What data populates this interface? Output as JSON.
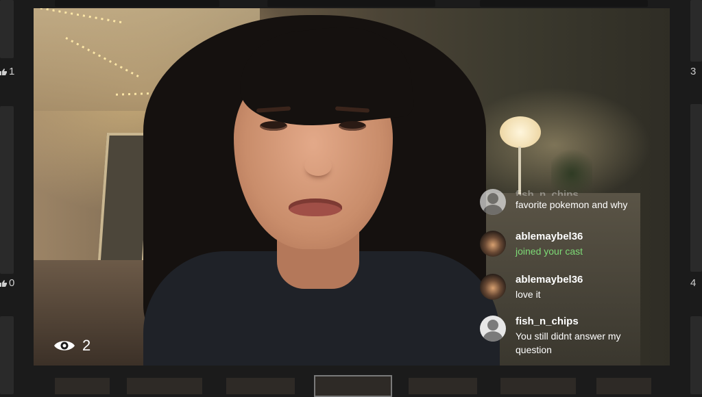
{
  "left_side": {
    "counts": [
      "1",
      "0"
    ]
  },
  "right_side": {
    "counts": [
      "3",
      "4"
    ]
  },
  "viewer_count": "2",
  "chat": [
    {
      "user": "fish_n_chips",
      "message": "favorite pokemon and why",
      "avatar": "default-avatar",
      "faded": true
    },
    {
      "user": "ablemaybel36",
      "message": "joined your cast",
      "avatar": "photo-avatar",
      "system": true
    },
    {
      "user": "ablemaybel36",
      "message": "love it",
      "avatar": "photo-avatar"
    },
    {
      "user": "fish_n_chips",
      "message": "You still didnt answer my question",
      "avatar": "default-avatar"
    }
  ],
  "colors": {
    "system_message": "#7ddb76",
    "background": "#1b1b1b"
  },
  "icons": {
    "viewers": "eye-icon",
    "likes": "thumbs-up-icon"
  }
}
